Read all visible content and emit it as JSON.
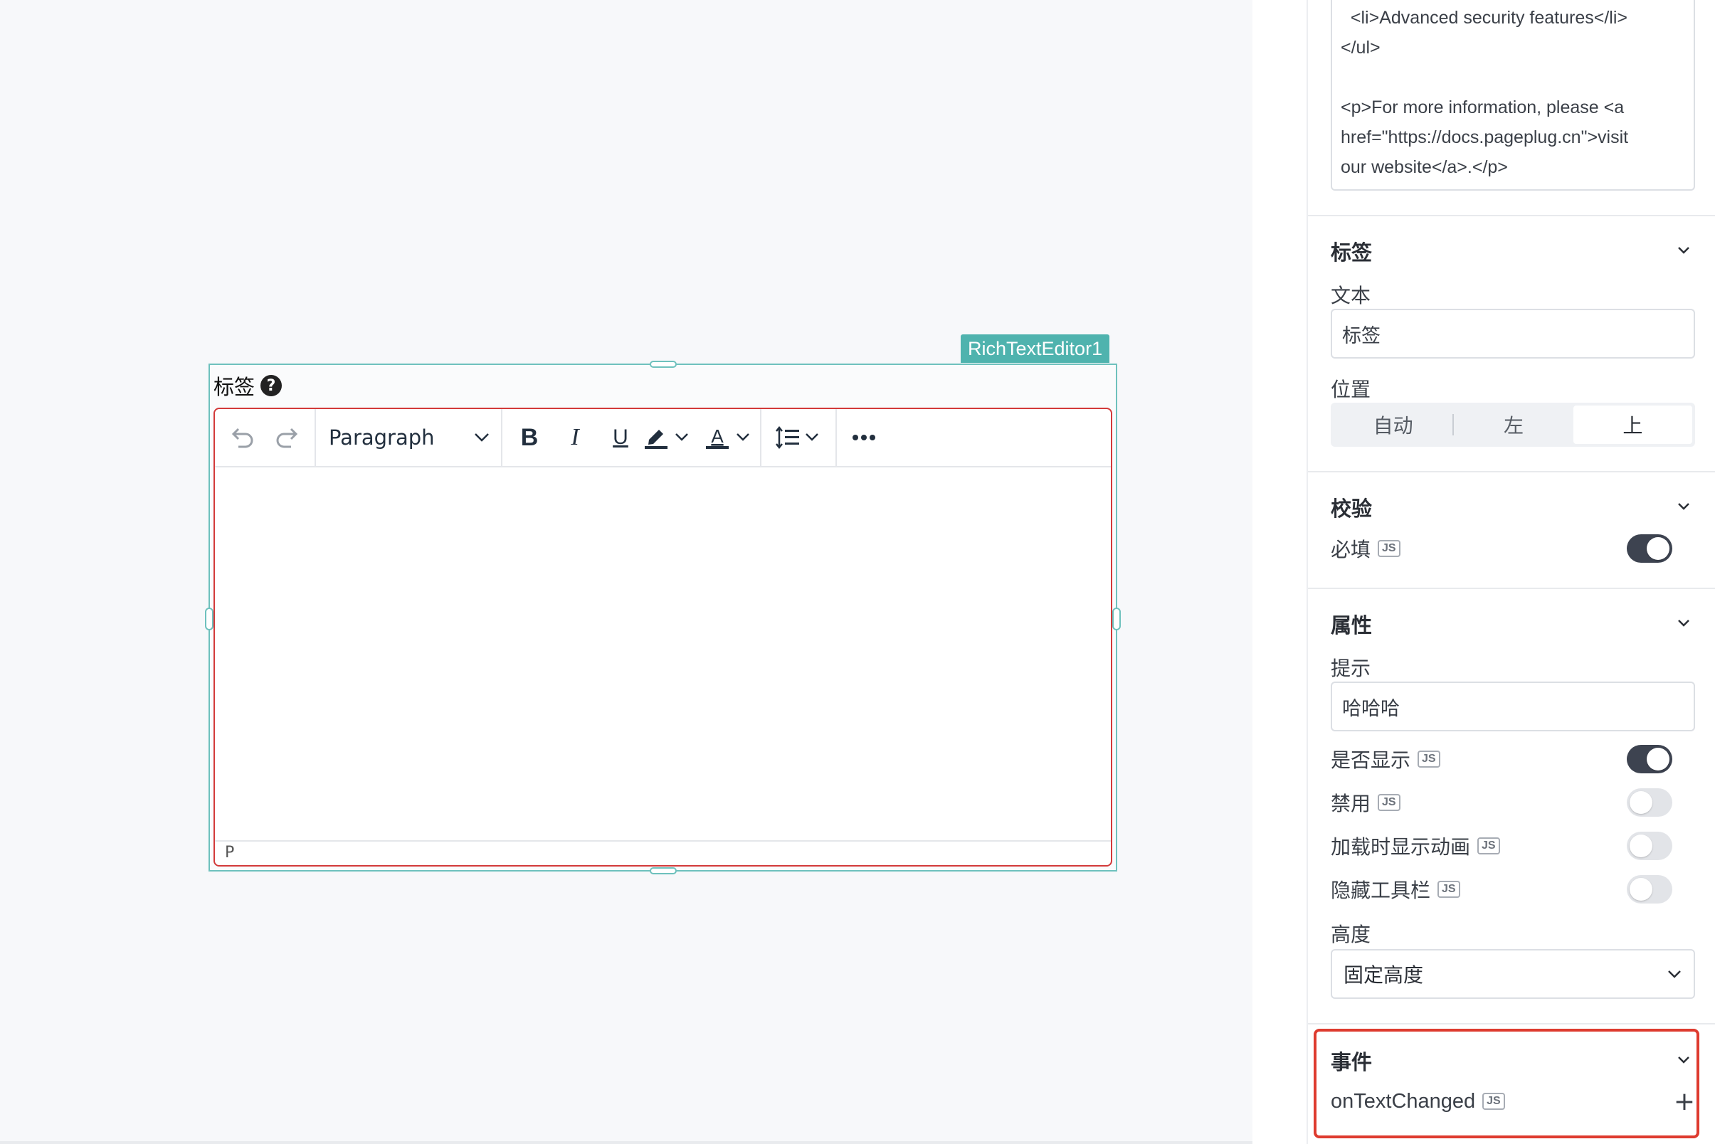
{
  "canvas": {
    "widget_name": "RichTextEditor1",
    "label": "标签",
    "editor": {
      "block_format": "Paragraph",
      "status_path": "P"
    }
  },
  "pane": {
    "code_lines": "  <li>Advanced security features</li>\n</ul>\n\n<p>For more information, please <a\nhref=\"https://docs.pageplug.cn\">visit\nour website</a>.</p>",
    "label_section": {
      "title": "标签",
      "text_label": "文本",
      "text_value": "标签",
      "position_label": "位置",
      "positions": [
        "自动",
        "左",
        "上"
      ],
      "active_position": "上"
    },
    "validation_section": {
      "title": "校验",
      "required_label": "必填",
      "required_on": true
    },
    "props_section": {
      "title": "属性",
      "tooltip_label": "提示",
      "tooltip_value": "哈哈哈",
      "visible_label": "是否显示",
      "visible_on": true,
      "disabled_label": "禁用",
      "disabled_on": false,
      "animate_label": "加载时显示动画",
      "animate_on": false,
      "hide_toolbar_label": "隐藏工具栏",
      "hide_toolbar_on": false,
      "height_label": "高度",
      "height_value": "固定高度"
    },
    "events_section": {
      "title": "事件",
      "event_name": "onTextChanged"
    },
    "js_badge": "JS"
  }
}
